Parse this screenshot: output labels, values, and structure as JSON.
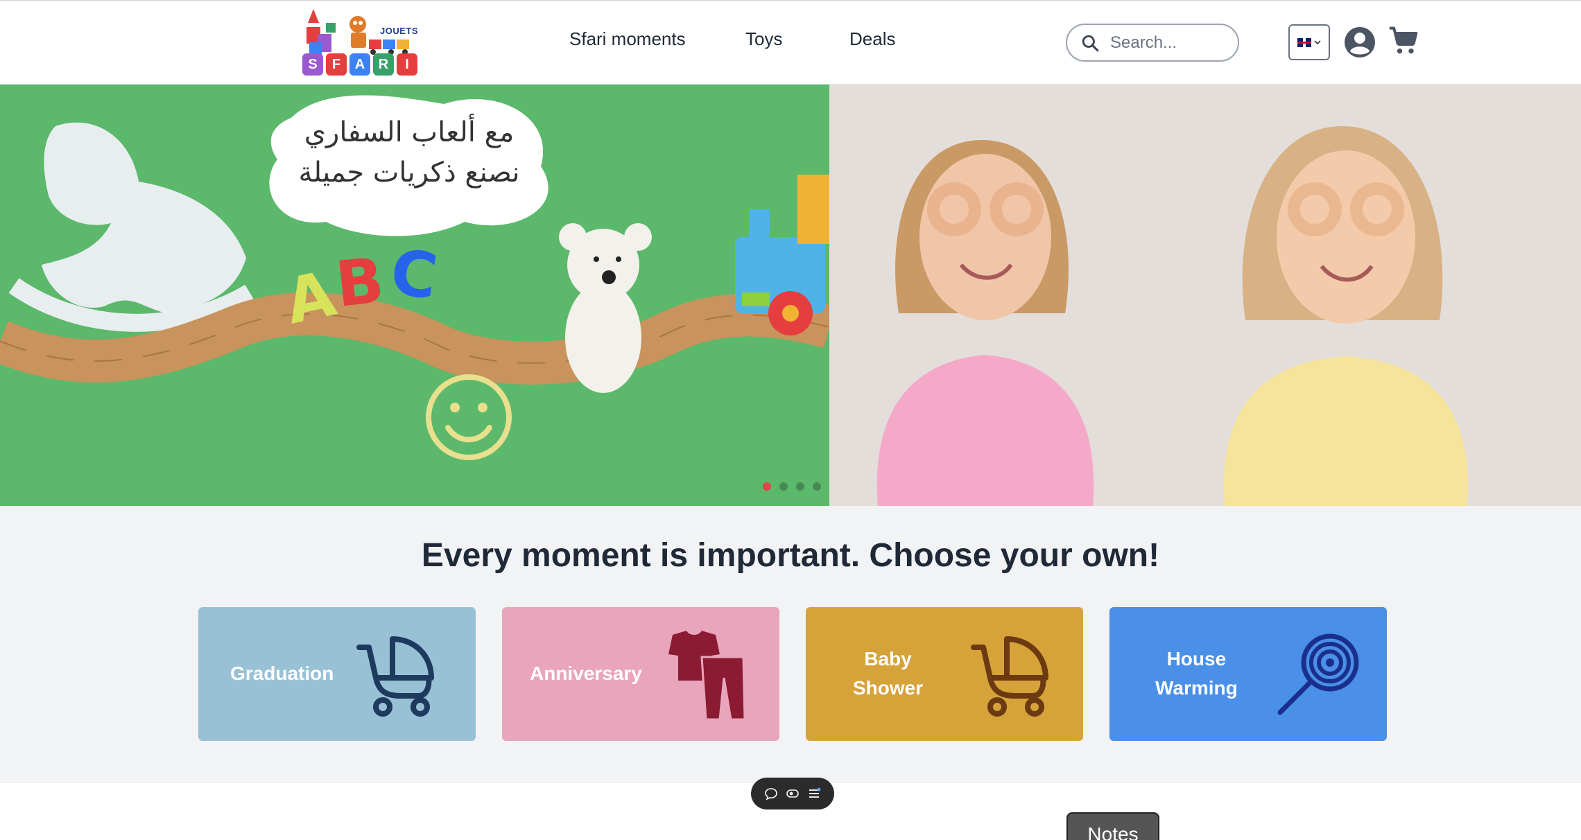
{
  "brand": {
    "name_letters": [
      "S",
      "F",
      "A",
      "R",
      "I"
    ],
    "letter_colors": [
      "#9b59d0",
      "#e53e3e",
      "#3b82f6",
      "#38a169",
      "#e53e3e"
    ],
    "tag": "JOUETS"
  },
  "nav": {
    "items": [
      {
        "label": "Sfari moments"
      },
      {
        "label": "Toys"
      },
      {
        "label": "Deals"
      }
    ]
  },
  "search": {
    "placeholder": "Search..."
  },
  "hero": {
    "bubble_line1": "مع ألعاب السفاري",
    "bubble_line2": "نصنع ذكريات جميلة",
    "letters": [
      "A",
      "B",
      "C"
    ],
    "slides_count": 4,
    "active_slide": 1
  },
  "moments": {
    "heading": "Every moment is important. Choose your own!",
    "cards": [
      {
        "line1": "Graduation",
        "line2": "",
        "color": "#99c1d6",
        "icon": "stroller-icon",
        "icon_color": "#1e3a5f"
      },
      {
        "line1": "Anniversary",
        "line2": "",
        "color": "#e8a5bb",
        "icon": "clothes-icon",
        "icon_color": "#8b1a33"
      },
      {
        "line1": "Baby",
        "line2": "Shower",
        "color": "#d6a23a",
        "icon": "stroller-icon",
        "icon_color": "#6b3a10"
      },
      {
        "line1": "House",
        "line2": "Warming",
        "color": "#4a8fe8",
        "icon": "lollipop-icon",
        "icon_color": "#1a2f8c"
      }
    ]
  },
  "overlay": {
    "notes_label": "Notes",
    "toolbar_icons": [
      "comment-icon",
      "eye-icon",
      "menu-icon"
    ]
  }
}
